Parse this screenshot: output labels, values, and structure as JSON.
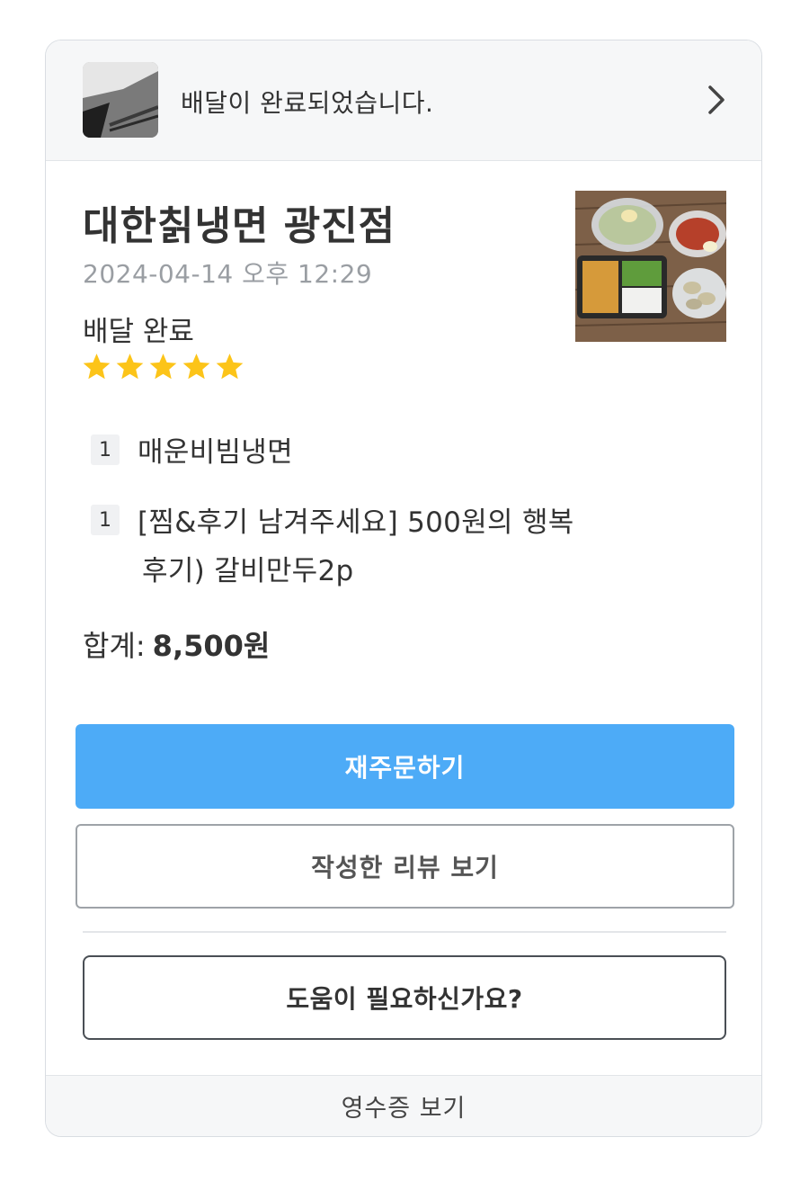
{
  "banner": {
    "message": "배달이 완료되었습니다."
  },
  "order": {
    "shop_name": "대한칡냉면 광진점",
    "datetime": "2024-04-14 오후 12:29",
    "status": "배달 완료",
    "rating": 5,
    "items": [
      {
        "qty": "1",
        "name": "매운비빔냉면"
      },
      {
        "qty": "1",
        "name_line1": "[찜&후기 남겨주세요] 500원의 행복",
        "name_line2": "후기) 갈비만두2p"
      }
    ],
    "total_label": "합계:",
    "total_value": "8,500원"
  },
  "actions": {
    "reorder": "재주문하기",
    "view_review": "작성한 리뷰 보기",
    "help": "도움이 필요하신가요?",
    "receipt": "영수증 보기"
  },
  "colors": {
    "primary_button": "#4dabf7",
    "star": "#fcc419"
  }
}
